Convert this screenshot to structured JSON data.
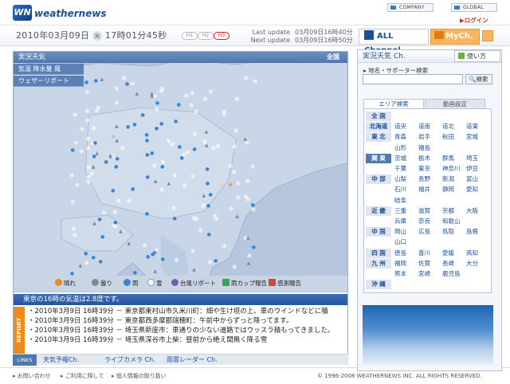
{
  "brand": {
    "logo_mark": "WN",
    "name": "weathernews"
  },
  "top_links": {
    "company": "COMPANY",
    "global": "GLOBAL",
    "login": "ログイン"
  },
  "time": {
    "date": "2010年03月09日",
    "dow": "火",
    "clock": "17時01分45秒",
    "modes": [
      "H1",
      "H2",
      "H3"
    ]
  },
  "updates": {
    "last_label": "Last update",
    "last_value": "03月09日16時40分",
    "next_label": "Next update",
    "next_value": "03月09日16時50分"
  },
  "channels": {
    "all": "ALL Channel",
    "my": "MyCh."
  },
  "map": {
    "title": "実況天気",
    "region": "全国",
    "tabs": [
      "気温 降水量 風",
      "ウェザーリポート"
    ],
    "legend": [
      {
        "label": "晴れ",
        "color": "#e68a1b"
      },
      {
        "label": "曇り",
        "color": "#888888"
      },
      {
        "label": "雨",
        "color": "#3b84d4"
      },
      {
        "label": "雪",
        "color": "#ffffff"
      },
      {
        "label": "台風リポート",
        "color": "#7a5aa8"
      },
      {
        "label": "雨カップ報告",
        "color": "#3aa25a"
      },
      {
        "label": "感測報告",
        "color": "#d6453b"
      }
    ]
  },
  "temperature_notice": "東京の16時の気温は2.8度です。",
  "report_tag": "REPORT",
  "reports": [
    "・2010年3月9日 16時39分 － 東京都東村山市久米川町：畑や生け垣の上、車のウインドなどに積",
    "・2010年3月9日 16時39分 － 東京都西多摩郡瑞穂町：午前中からずっと降ってます。",
    "・2010年3月9日 16時39分 － 埼玉県新座市：車通りの少ない道路ではウッスラ積もってきました。",
    "・2010年3月9日 16時39分 － 埼玉県深谷市上柴：昼前から絶え間無く降る雪"
  ],
  "links": {
    "label": "LINKS",
    "items": [
      "天気予報Ch.",
      "ライブカメラ Ch.",
      "雨雲レーダー Ch."
    ]
  },
  "footer": {
    "items": [
      "お問い合わせ",
      "ご利用に際して",
      "個人情報の取り扱い"
    ],
    "copyright": "© 1996-2008 WEATHERNEWS INC. ALL RIGHTS RESERVED."
  },
  "right": {
    "title": "実況天気 Ch.",
    "howto": "使い方",
    "search_label": "地名・サポーター検索",
    "search_placeholder": "",
    "search_button": "検索",
    "tabs": [
      "エリア検索",
      "動画設定"
    ],
    "areas": [
      {
        "region": "全 国",
        "prefs": []
      },
      {
        "region": "北海道",
        "prefs": [
          "道央",
          "道南",
          "道北",
          "道東"
        ]
      },
      {
        "region": "東 北",
        "prefs": [
          "青森",
          "岩手",
          "秋田",
          "宮城"
        ]
      },
      {
        "region": "",
        "prefs": [
          "山形",
          "福島"
        ]
      },
      {
        "region": "関 東",
        "prefs": [
          "茨城",
          "栃木",
          "群馬",
          "埼玉"
        ],
        "selected": true
      },
      {
        "region": "",
        "prefs": [
          "千葉",
          "東京",
          "神奈川",
          "伊豆"
        ]
      },
      {
        "region": "中 部",
        "prefs": [
          "山梨",
          "長野",
          "新潟",
          "富山"
        ]
      },
      {
        "region": "",
        "prefs": [
          "石川",
          "福井",
          "静岡",
          "愛知"
        ]
      },
      {
        "region": "",
        "prefs": [
          "岐阜"
        ]
      },
      {
        "region": "近 畿",
        "prefs": [
          "三重",
          "滋賀",
          "京都",
          "大阪"
        ]
      },
      {
        "region": "",
        "prefs": [
          "兵庫",
          "奈良",
          "和歌山"
        ]
      },
      {
        "region": "中 国",
        "prefs": [
          "岡山",
          "広島",
          "鳥取",
          "島根"
        ]
      },
      {
        "region": "",
        "prefs": [
          "山口"
        ]
      },
      {
        "region": "四 国",
        "prefs": [
          "徳島",
          "香川",
          "愛媛",
          "高知"
        ]
      },
      {
        "region": "九 州",
        "prefs": [
          "福岡",
          "佐賀",
          "長崎",
          "大分"
        ]
      },
      {
        "region": "",
        "prefs": [
          "熊本",
          "宮崎",
          "鹿児島"
        ]
      },
      {
        "region": "沖 縄",
        "prefs": []
      }
    ]
  }
}
